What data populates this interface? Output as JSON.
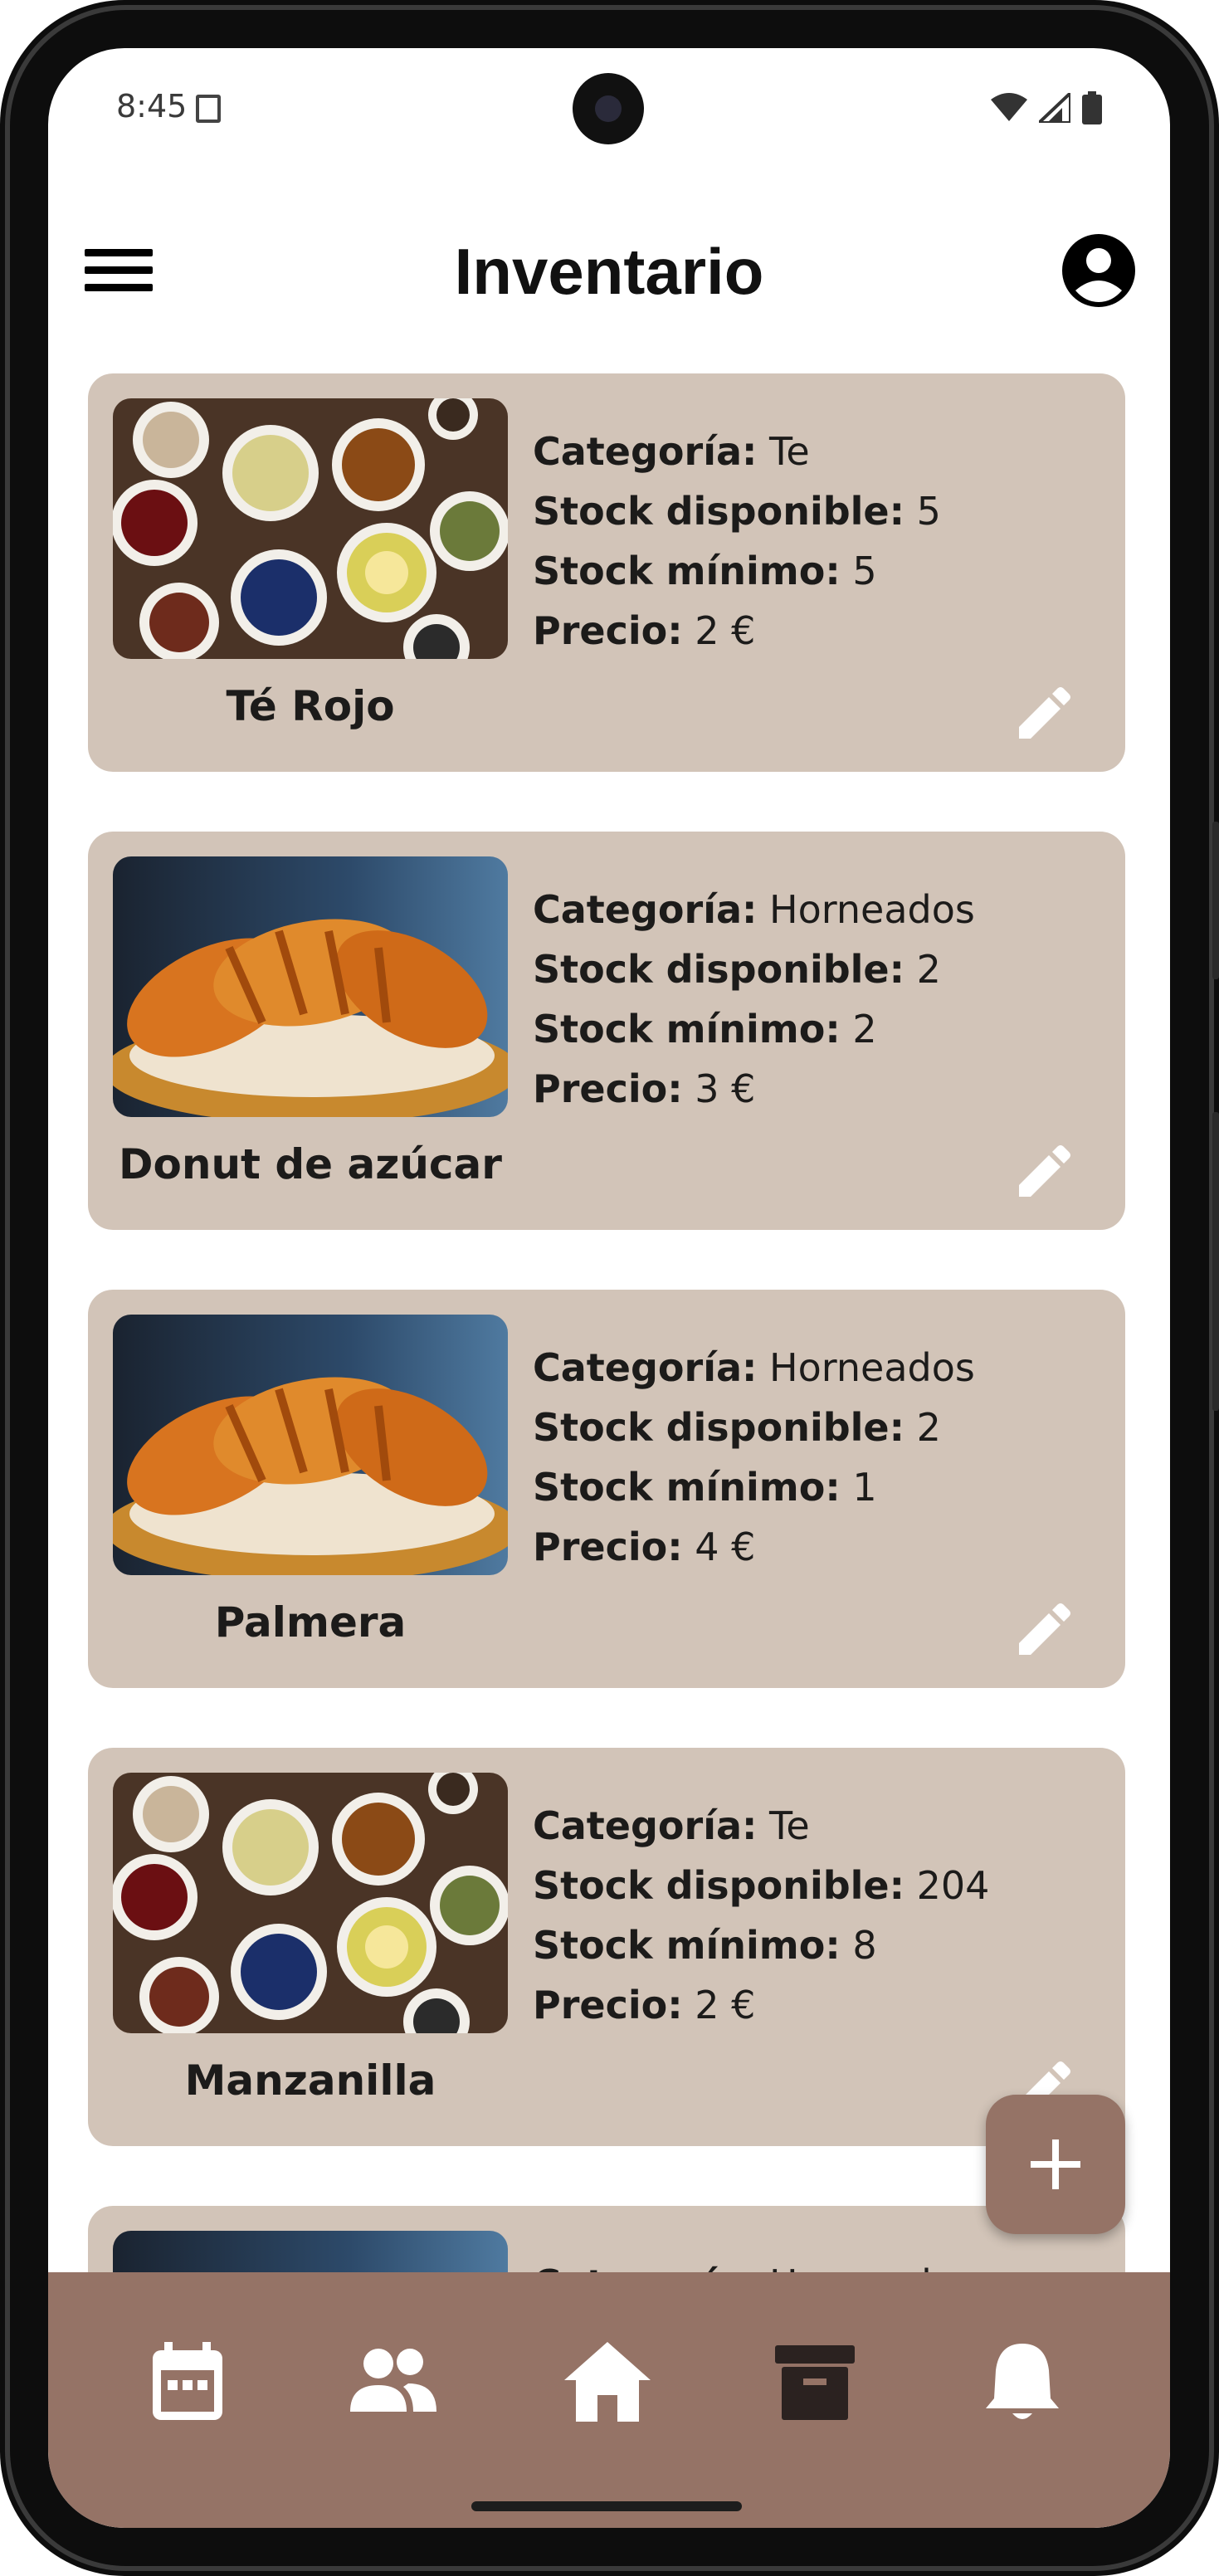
{
  "status_bar": {
    "time": "8:45"
  },
  "app_bar": {
    "title": "Inventario"
  },
  "labels": {
    "category": "Categoría:",
    "stock_available": "Stock disponible:",
    "stock_min": "Stock mínimo:",
    "price": "Precio:"
  },
  "products": [
    {
      "name": "Té Rojo",
      "category": "Te",
      "stock_available": "5",
      "stock_min": "5",
      "price": "2 €",
      "image": "tea"
    },
    {
      "name": "Donut de azúcar",
      "category": "Horneados",
      "stock_available": "2",
      "stock_min": "2",
      "price": "3 €",
      "image": "croissants"
    },
    {
      "name": "Palmera",
      "category": "Horneados",
      "stock_available": "2",
      "stock_min": "1",
      "price": "4 €",
      "image": "croissants"
    },
    {
      "name": "Manzanilla",
      "category": "Te",
      "stock_available": "204",
      "stock_min": "8",
      "price": "2 €",
      "image": "tea"
    },
    {
      "name": "",
      "category": "Horneados",
      "stock_available": "",
      "stock_min": "",
      "price": "",
      "image": "croissants"
    }
  ],
  "bottom_nav": {
    "items": [
      {
        "icon": "calendar-icon"
      },
      {
        "icon": "people-icon"
      },
      {
        "icon": "home-icon"
      },
      {
        "icon": "archive-icon",
        "active": true
      },
      {
        "icon": "bell-icon"
      }
    ]
  },
  "colors": {
    "card": "#d2c4b8",
    "accent": "#957366",
    "nav_active": "#2b2220",
    "icon": "#ffffff"
  }
}
